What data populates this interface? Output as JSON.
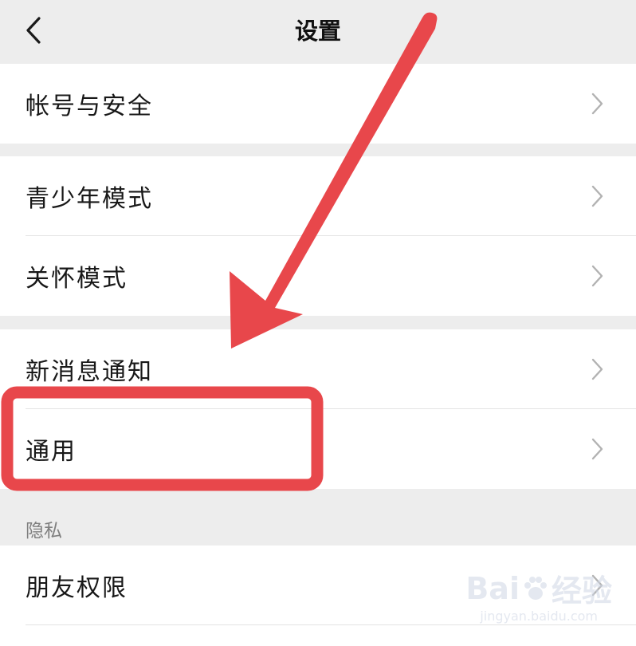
{
  "nav": {
    "title": "设置",
    "back_icon": "chevron-left-icon"
  },
  "groups": [
    {
      "items": [
        {
          "label": "帐号与安全"
        }
      ]
    },
    {
      "items": [
        {
          "label": "青少年模式"
        },
        {
          "label": "关怀模式"
        }
      ]
    },
    {
      "items": [
        {
          "label": "新消息通知"
        },
        {
          "label": "通用"
        }
      ]
    }
  ],
  "privacy": {
    "header": "隐私",
    "items": [
      {
        "label": "朋友权限"
      }
    ]
  },
  "annotation": {
    "color": "#e8474b",
    "highlighted_item": "通用"
  },
  "watermark": {
    "brand": "Bai",
    "brand_tail": "经验",
    "url": "jingyan.baidu.com"
  }
}
